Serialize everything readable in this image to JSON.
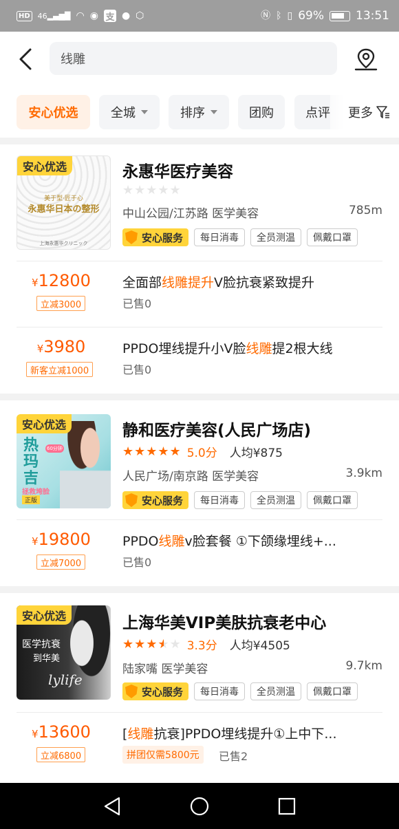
{
  "status_bar": {
    "hd": "HD",
    "signal": "46",
    "battery": "69%",
    "time": "13:51",
    "icons": [
      "wifi-icon",
      "eye-icon",
      "alipay-icon",
      "chat-icon",
      "settings-icon",
      "nfc-icon",
      "bluetooth-icon",
      "vibrate-icon"
    ]
  },
  "header": {
    "search_value": "线雕"
  },
  "filters": {
    "items": [
      "安心优选",
      "全城",
      "排序",
      "团购",
      "点评"
    ],
    "more_label": "更多"
  },
  "shops": [
    {
      "badge": "安心优选",
      "thumb_lines": [
        "美于型·匠于心",
        "永惠华日本の整形",
        "上海永惠华クリニック"
      ],
      "name": "永惠华医疗美容",
      "rating_stars": 0,
      "location": "中山公园/江苏路  医学美容",
      "distance": "785m",
      "tags": [
        "安心服务",
        "每日消毒",
        "全员测温",
        "佩戴口罩"
      ],
      "deals": [
        {
          "price": "12800",
          "discount": "立减3000",
          "title_parts": [
            "全面部",
            "线雕提升",
            "V脸抗衰紧致提升"
          ],
          "sold": "已售0"
        },
        {
          "price": "3980",
          "discount": "新客立减1000",
          "title_parts": [
            "PPDO埋线提升小V脸",
            "线雕",
            "提2根大线"
          ],
          "sold": "已售0"
        }
      ]
    },
    {
      "badge": "安心优选",
      "thumb_lines": [
        "热",
        "玛",
        "吉",
        "60分钟",
        "拯救垮脸",
        "正版"
      ],
      "name": "静和医疗美容(人民广场店)",
      "rating_stars": 5,
      "score": "5.0分",
      "avg": "人均¥875",
      "location": "人民广场/南京路  医学美容",
      "distance": "3.9km",
      "tags": [
        "安心服务",
        "每日消毒",
        "全员测温",
        "佩戴口罩"
      ],
      "deals": [
        {
          "price": "19800",
          "discount": "立减7000",
          "title_parts": [
            "PPDO",
            "线雕",
            "v脸套餐 ①下颌缘埋线+..."
          ],
          "sold": "已售0"
        }
      ]
    },
    {
      "badge": "安心优选",
      "thumb_lines": [
        "医学抗衰",
        "到华美",
        "lylife"
      ],
      "name": "上海华美VIP美肤抗衰老中心",
      "rating_stars": 3.5,
      "score": "3.3分",
      "avg": "人均¥4505",
      "location": "陆家嘴  医学美容",
      "distance": "9.7km",
      "tags": [
        "安心服务",
        "每日消毒",
        "全员测温",
        "佩戴口罩"
      ],
      "deals": [
        {
          "price": "13600",
          "discount": "立减6800",
          "title_parts": [
            "[",
            "线雕",
            "抗衰]PPDO埋线提升①上中下..."
          ],
          "group": "拼团仅需5800元",
          "sold": "已售2"
        }
      ]
    }
  ],
  "currency": "¥",
  "colors": {
    "accent": "#ff6a00",
    "badge": "#ffd43a"
  }
}
